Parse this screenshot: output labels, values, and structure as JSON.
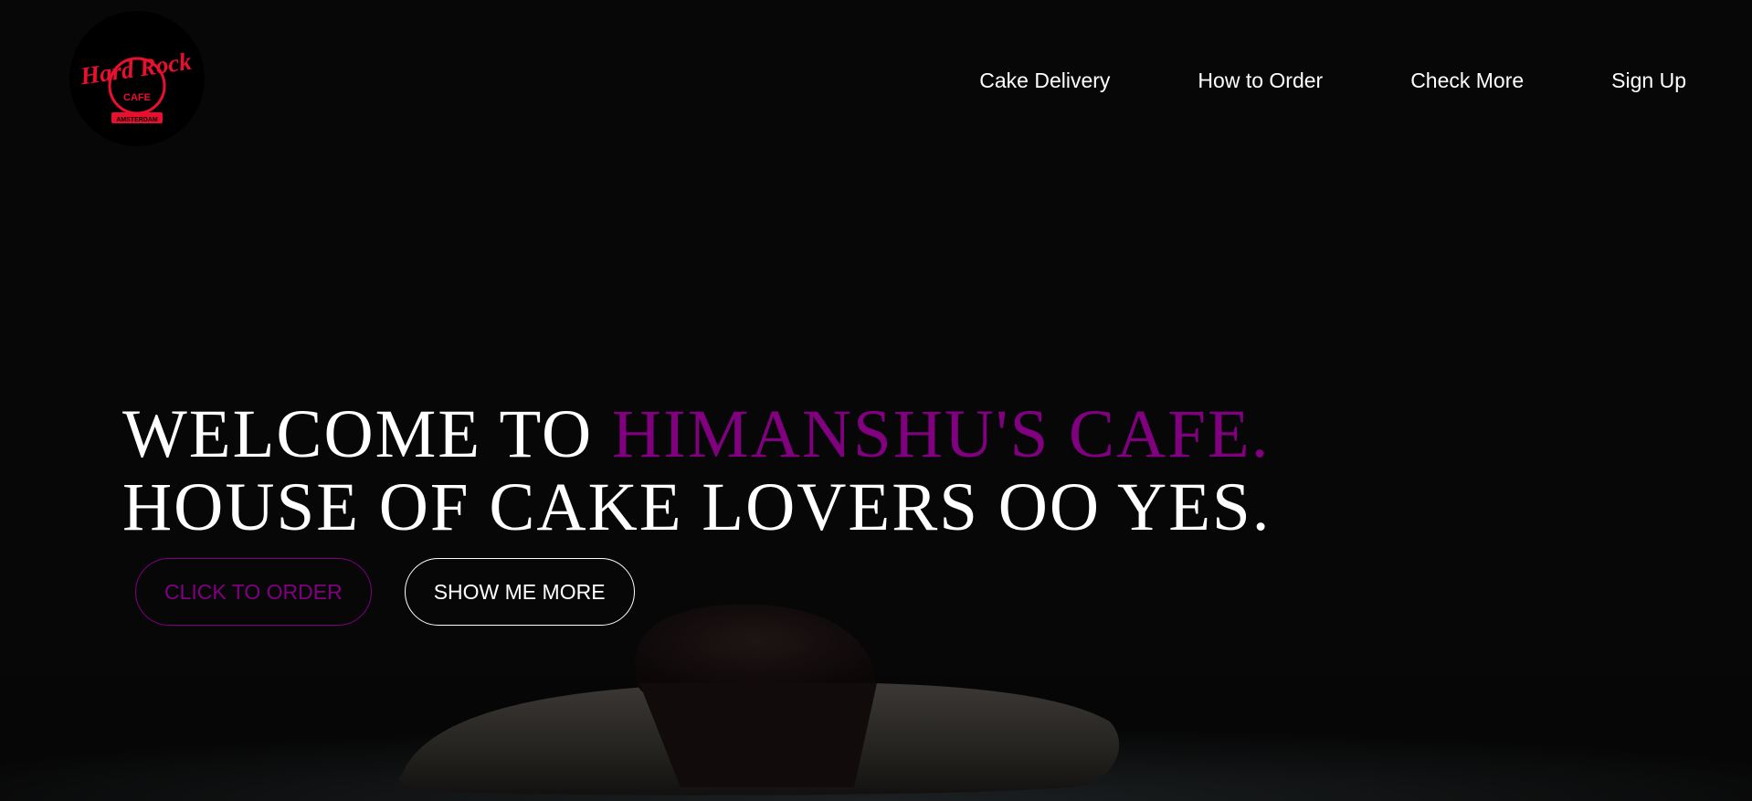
{
  "logo": {
    "brand_line1": "Hard Rock",
    "brand_line2": "CAFE",
    "brand_line3": "AMSTERDAM"
  },
  "nav": {
    "items": [
      {
        "label": "Cake Delivery"
      },
      {
        "label": "How to Order"
      },
      {
        "label": "Check More"
      },
      {
        "label": "Sign Up"
      }
    ]
  },
  "hero": {
    "line1_prefix": "WELCOME TO ",
    "line1_accent": "HIMANSHU'S CAFE.",
    "line2": "HOUSE OF CAKE LOVERS OO YES.",
    "primary_button": "CLICK TO ORDER",
    "secondary_button": "SHOW ME MORE"
  },
  "colors": {
    "accent": "#800080",
    "text": "#ffffff",
    "background": "#070707",
    "logo_red": "#e8102e"
  }
}
